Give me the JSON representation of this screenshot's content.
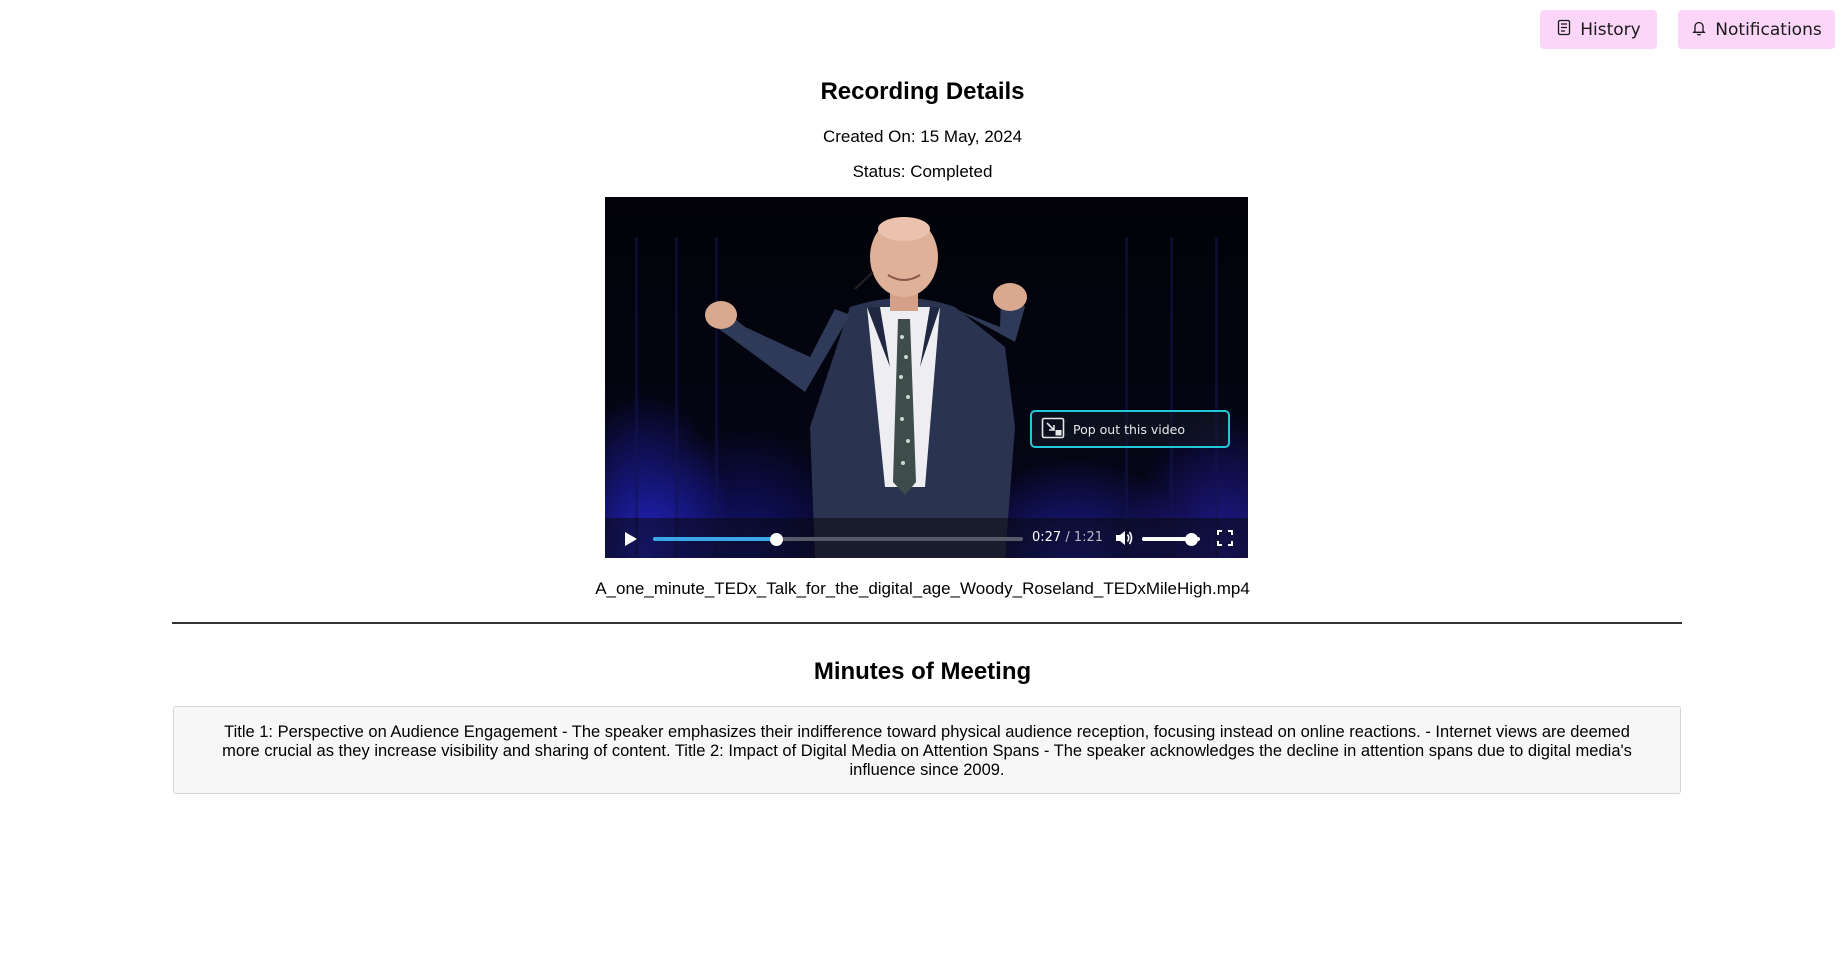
{
  "header": {
    "history_label": "History",
    "history_icon": "history-icon",
    "notifications_label": "Notifications",
    "notifications_icon": "bell-icon",
    "button_color": "#fbd6f8"
  },
  "recording": {
    "title": "Recording Details",
    "created_on": "Created On: 15 May, 2024",
    "status": "Status: Completed",
    "filename": "A_one_minute_TEDx_Talk_for_the_digital_age_Woody_Roseland_TEDxMileHigh.mp4"
  },
  "player": {
    "popout_label": "Pop out this video",
    "current_time": "0:27",
    "separator": "/",
    "duration": "1:21",
    "progress_fraction": 0.333,
    "volume_fraction": 0.85,
    "accent_color": "#3aa8e8",
    "popout_border_color": "#22c8d8"
  },
  "minutes": {
    "title": "Minutes of Meeting",
    "body": "Title 1: Perspective on Audience Engagement - The speaker emphasizes their indifference toward physical audience reception, focusing instead on online reactions. - Internet views are deemed more crucial as they increase visibility and sharing of content. Title 2: Impact of Digital Media on Attention Spans - The speaker acknowledges the decline in attention spans due to digital media's influence since 2009."
  }
}
